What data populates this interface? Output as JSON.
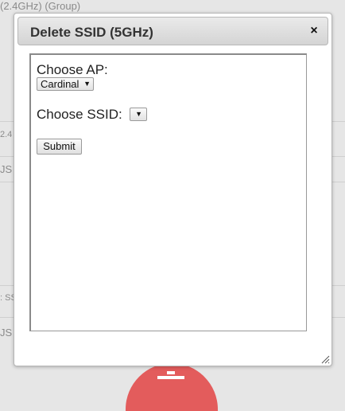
{
  "background": {
    "group_text": "(2.4GHz) (Group)",
    "row_fragment_1": "2.4",
    "row_fragment_2": "JS",
    "row_fragment_3": ": SS",
    "row_fragment_4": "JS",
    "fab_color": "#e35c5c",
    "fab_icon": "trash-icon"
  },
  "dialog": {
    "title": "Delete SSID (5GHz)",
    "close_label": "×",
    "choose_ap_label": "Choose AP:",
    "ap_select_value": "Cardinal",
    "choose_ssid_label": "Choose SSID:",
    "ssid_select_value": "",
    "dropdown_arrow": "▼",
    "submit_label": "Submit",
    "resize_icon": "resize-grip-icon"
  }
}
